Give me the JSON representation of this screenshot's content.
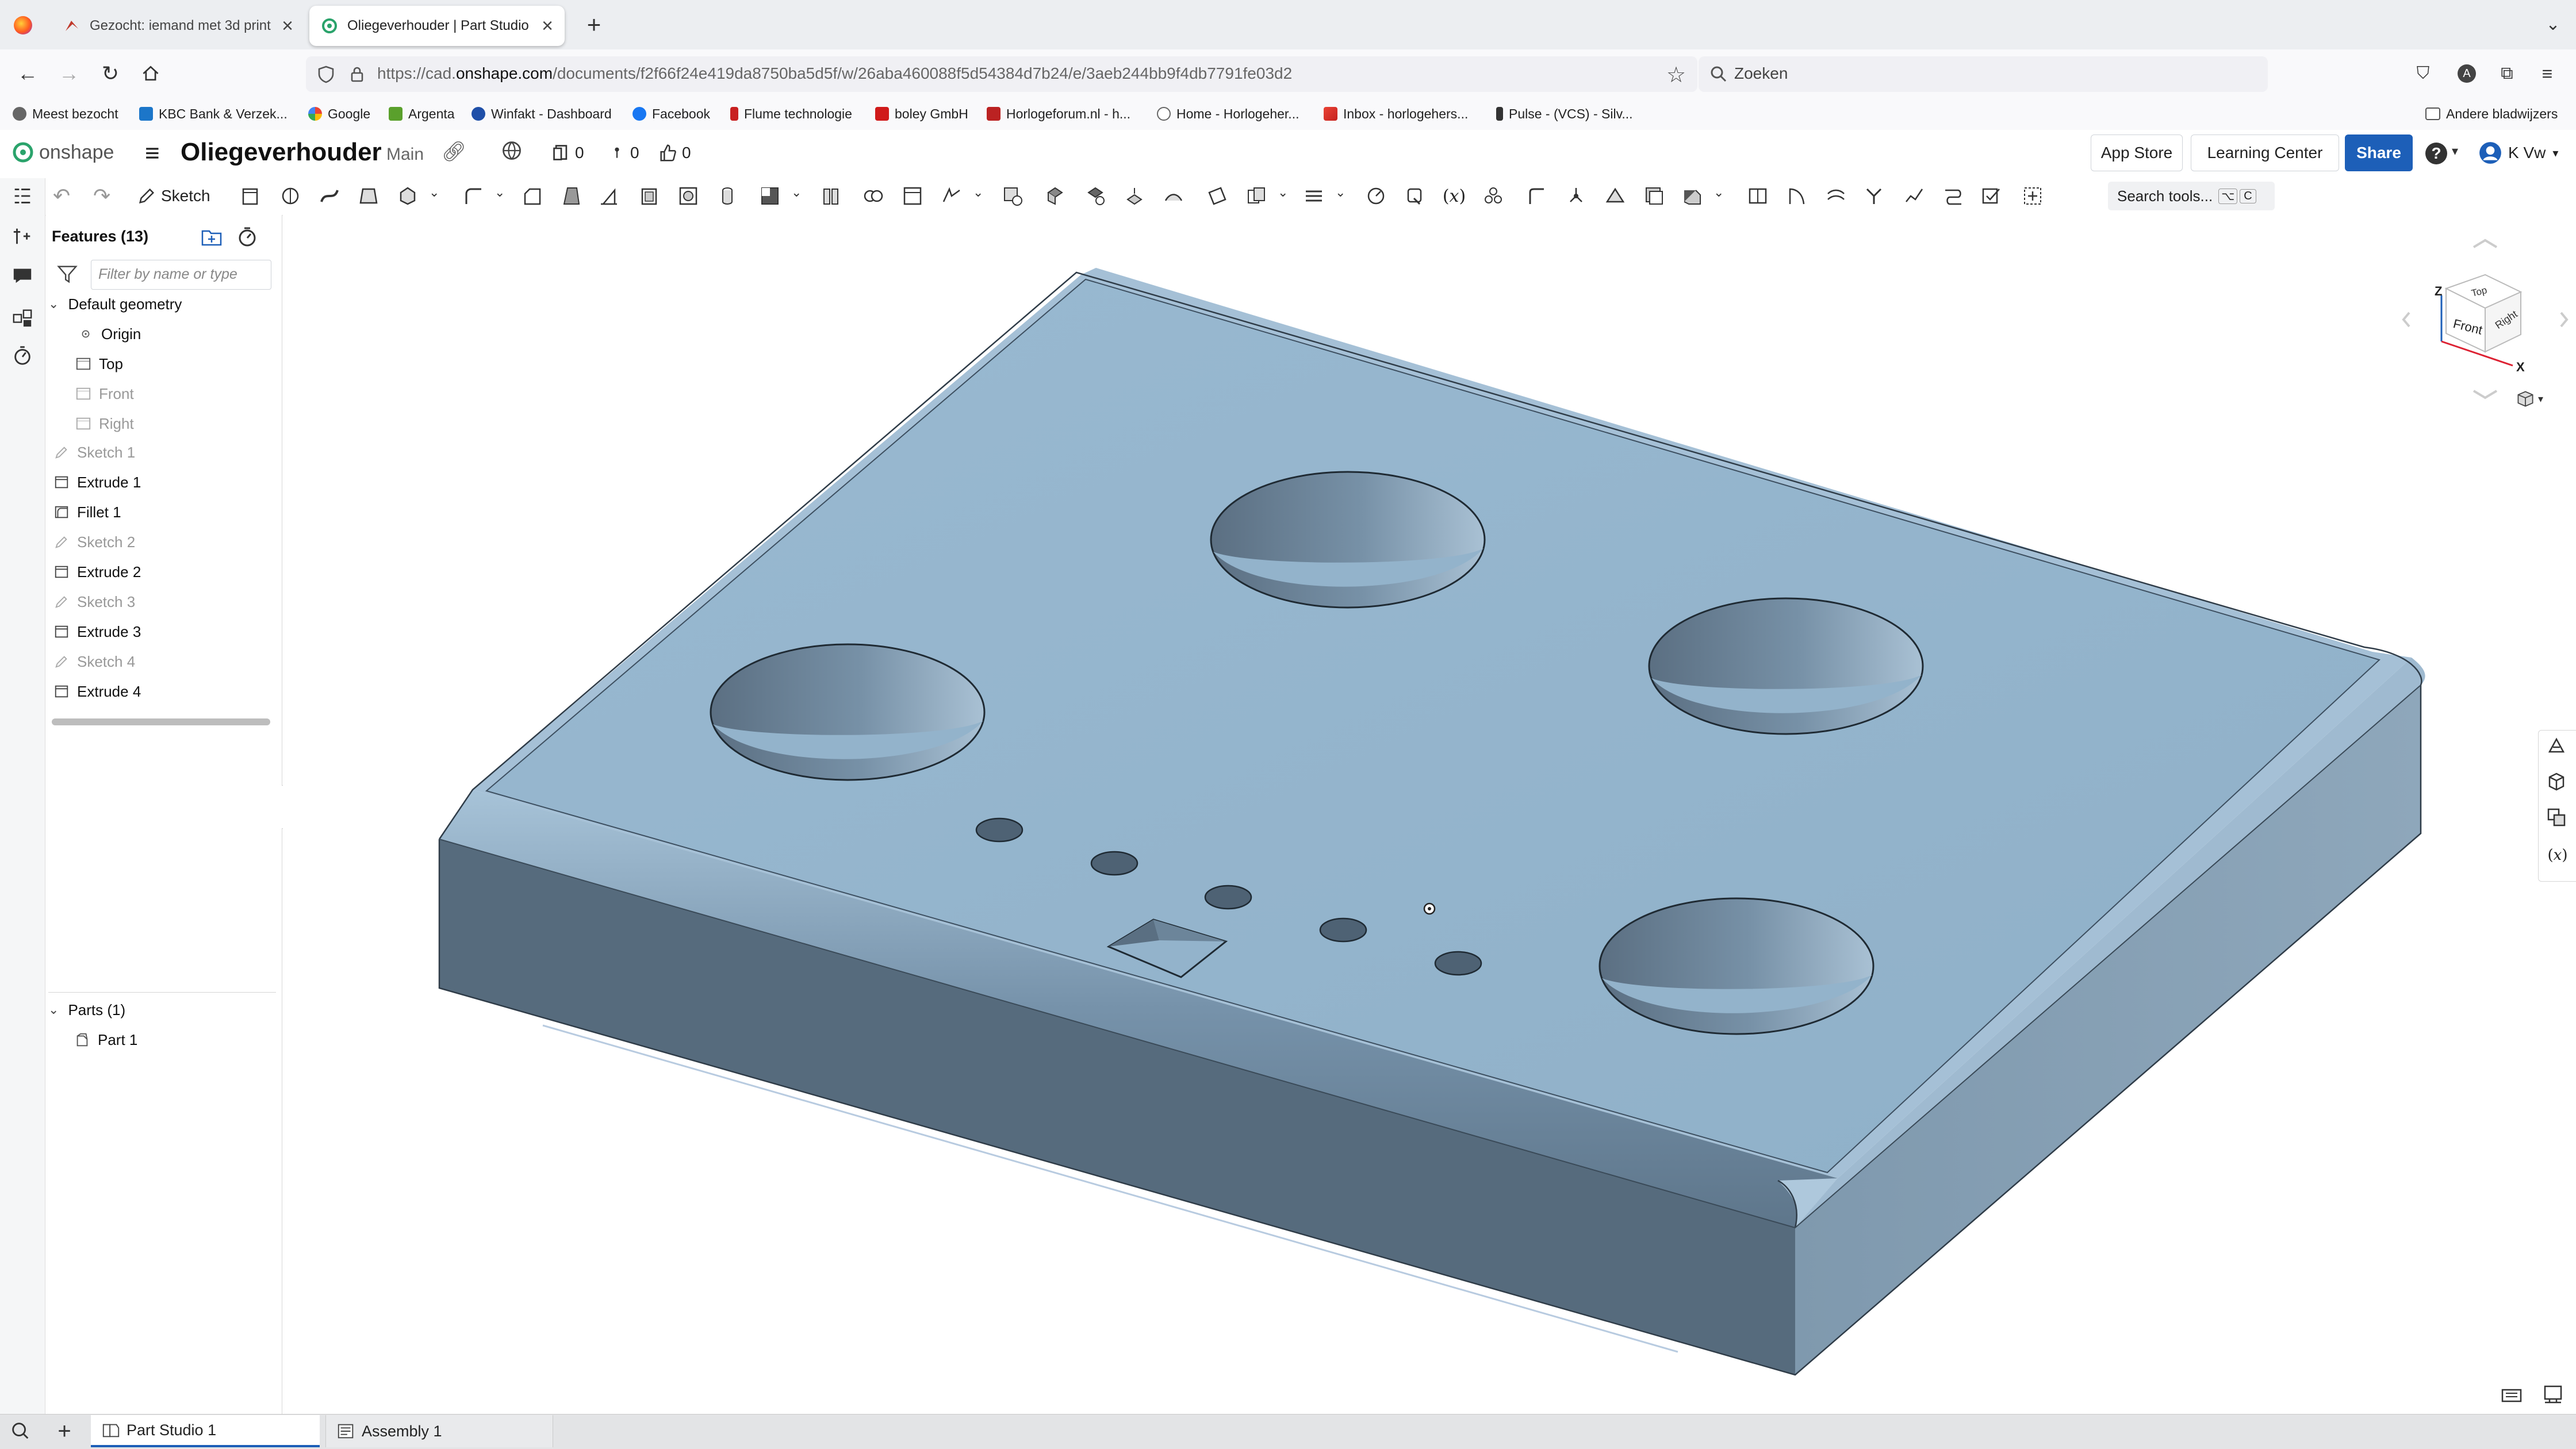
{
  "browser": {
    "tabs": [
      {
        "title": "Gezocht: iemand met 3d print e",
        "active": false,
        "icon": "brand-icon"
      },
      {
        "title": "Oliegeverhouder | Part Studio 1",
        "active": true,
        "icon": "onshape-icon"
      }
    ],
    "url_prefix": "https://cad.",
    "url_domain": "onshape.com",
    "url_path": "/documents/f2f66f24e419da8750ba5d5f/w/26aba460088f5d54384d7b24/e/3aeb244bb9f4db7791fe03d2",
    "search_placeholder": "Zoeken",
    "bookmarks": [
      "Meest bezocht",
      "KBC Bank & Verzek...",
      "Google",
      "Argenta",
      "Winfakt - Dashboard",
      "Facebook",
      "Flume technologie",
      "boley GmbH",
      "Horlogeforum.nl - h...",
      "Home - Horlogeher...",
      "Inbox - horlogehers...",
      "Pulse - (VCS) - Silv..."
    ],
    "bookmarks_other": "Andere bladwijzers"
  },
  "header": {
    "logo_text": "onshape",
    "doc_title": "Oliegeverhouder",
    "branch": "Main",
    "count_versions": "0",
    "count_branches": "0",
    "count_likes": "0",
    "app_store": "App Store",
    "learning_center": "Learning Center",
    "share": "Share",
    "help": "?",
    "user": "K Vw"
  },
  "toolbar": {
    "sketch_label": "Sketch",
    "search_tools": "Search tools...",
    "shortcut_1": "⌥",
    "shortcut_2": "C"
  },
  "features": {
    "header": "Features (13)",
    "filter_placeholder": "Filter by name or type",
    "default_geometry": "Default geometry",
    "origin": "Origin",
    "planes": [
      "Top",
      "Front",
      "Right"
    ],
    "items": [
      {
        "label": "Sketch 1",
        "type": "sketch"
      },
      {
        "label": "Extrude 1",
        "type": "extrude"
      },
      {
        "label": "Fillet 1",
        "type": "fillet"
      },
      {
        "label": "Sketch 2",
        "type": "sketch"
      },
      {
        "label": "Extrude 2",
        "type": "extrude"
      },
      {
        "label": "Sketch 3",
        "type": "sketch"
      },
      {
        "label": "Extrude 3",
        "type": "extrude"
      },
      {
        "label": "Sketch 4",
        "type": "sketch"
      },
      {
        "label": "Extrude 4",
        "type": "extrude"
      }
    ],
    "parts_header": "Parts (1)",
    "parts": [
      "Part 1"
    ]
  },
  "viewcube": {
    "top": "Top",
    "front": "Front",
    "right": "Right",
    "axis_x": "X",
    "axis_z": "Z"
  },
  "colors": {
    "accent": "#1d5fb8",
    "model_top": "#93b4cc",
    "model_side_dark": "#566b7d",
    "model_side_right": "#8aa2b6"
  },
  "tabs_bottom": [
    {
      "label": "Part Studio 1",
      "active": true
    },
    {
      "label": "Assembly 1",
      "active": false
    }
  ]
}
